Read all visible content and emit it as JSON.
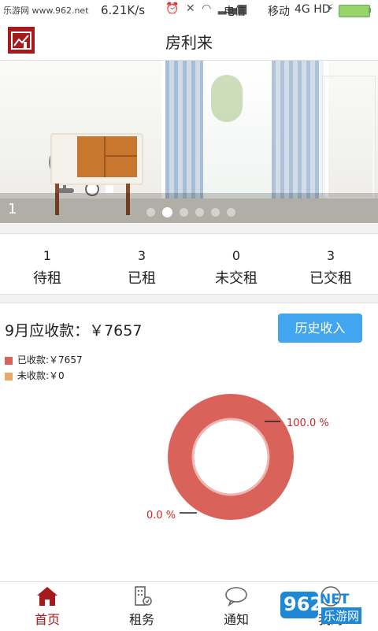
{
  "status_bar": {
    "site": "乐游网 www.962.net",
    "speed": "6.21K/s",
    "carrier1": "电信",
    "carrier2": "移动",
    "network": "4G HD"
  },
  "header": {
    "title": "房利来"
  },
  "banner": {
    "page_number": "1",
    "dots": 6,
    "active_dot": 1
  },
  "stats": [
    {
      "value": "1",
      "label": "待租"
    },
    {
      "value": "3",
      "label": "已租"
    },
    {
      "value": "0",
      "label": "未交租"
    },
    {
      "value": "3",
      "label": "已交租"
    }
  ],
  "income": {
    "title": "9月应收款：￥7657",
    "history_button": "历史收入",
    "legend": [
      {
        "label": "已收款:￥7657",
        "color": "#d9635a"
      },
      {
        "label": "未收款:￥0",
        "color": "#e8a96a"
      }
    ]
  },
  "chart_data": {
    "type": "pie",
    "style": "donut",
    "slices": [
      {
        "name": "已收款",
        "value": 7657,
        "percent_label": "100.0 %",
        "color": "#d9635a"
      },
      {
        "name": "未收款",
        "value": 0,
        "percent_label": "0.0 %",
        "color": "#e8a96a"
      }
    ]
  },
  "bottom_nav": [
    {
      "label": "首页",
      "icon": "home-icon",
      "active": true
    },
    {
      "label": "租务",
      "icon": "building-icon",
      "active": false
    },
    {
      "label": "通知",
      "icon": "chat-bubble-icon",
      "active": false
    },
    {
      "label": "我的",
      "icon": "user-icon",
      "active": false
    }
  ],
  "watermark": {
    "number": "962",
    "net": "NET",
    "text": "乐游网"
  },
  "colors": {
    "accent": "#a8191d",
    "button": "#42a5f0",
    "received": "#d9635a",
    "unreceived": "#e8a96a"
  }
}
